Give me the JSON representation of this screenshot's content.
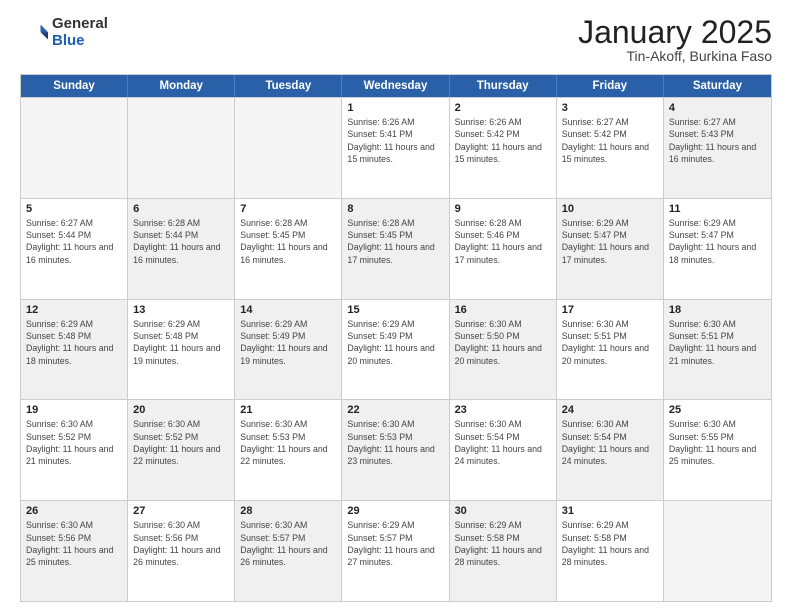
{
  "header": {
    "logo_general": "General",
    "logo_blue": "Blue",
    "title": "January 2025",
    "location": "Tin-Akoff, Burkina Faso"
  },
  "days_of_week": [
    "Sunday",
    "Monday",
    "Tuesday",
    "Wednesday",
    "Thursday",
    "Friday",
    "Saturday"
  ],
  "rows": [
    [
      {
        "day": "",
        "empty": true
      },
      {
        "day": "",
        "empty": true
      },
      {
        "day": "",
        "empty": true
      },
      {
        "day": "1",
        "sunrise": "6:26 AM",
        "sunset": "5:41 PM",
        "daylight": "11 hours and 15 minutes."
      },
      {
        "day": "2",
        "sunrise": "6:26 AM",
        "sunset": "5:42 PM",
        "daylight": "11 hours and 15 minutes."
      },
      {
        "day": "3",
        "sunrise": "6:27 AM",
        "sunset": "5:42 PM",
        "daylight": "11 hours and 15 minutes."
      },
      {
        "day": "4",
        "sunrise": "6:27 AM",
        "sunset": "5:43 PM",
        "daylight": "11 hours and 16 minutes.",
        "shaded": true
      }
    ],
    [
      {
        "day": "5",
        "sunrise": "6:27 AM",
        "sunset": "5:44 PM",
        "daylight": "11 hours and 16 minutes."
      },
      {
        "day": "6",
        "sunrise": "6:28 AM",
        "sunset": "5:44 PM",
        "daylight": "11 hours and 16 minutes.",
        "shaded": true
      },
      {
        "day": "7",
        "sunrise": "6:28 AM",
        "sunset": "5:45 PM",
        "daylight": "11 hours and 16 minutes."
      },
      {
        "day": "8",
        "sunrise": "6:28 AM",
        "sunset": "5:45 PM",
        "daylight": "11 hours and 17 minutes.",
        "shaded": true
      },
      {
        "day": "9",
        "sunrise": "6:28 AM",
        "sunset": "5:46 PM",
        "daylight": "11 hours and 17 minutes."
      },
      {
        "day": "10",
        "sunrise": "6:29 AM",
        "sunset": "5:47 PM",
        "daylight": "11 hours and 17 minutes.",
        "shaded": true
      },
      {
        "day": "11",
        "sunrise": "6:29 AM",
        "sunset": "5:47 PM",
        "daylight": "11 hours and 18 minutes."
      }
    ],
    [
      {
        "day": "12",
        "sunrise": "6:29 AM",
        "sunset": "5:48 PM",
        "daylight": "11 hours and 18 minutes.",
        "shaded": true
      },
      {
        "day": "13",
        "sunrise": "6:29 AM",
        "sunset": "5:48 PM",
        "daylight": "11 hours and 19 minutes."
      },
      {
        "day": "14",
        "sunrise": "6:29 AM",
        "sunset": "5:49 PM",
        "daylight": "11 hours and 19 minutes.",
        "shaded": true
      },
      {
        "day": "15",
        "sunrise": "6:29 AM",
        "sunset": "5:49 PM",
        "daylight": "11 hours and 20 minutes."
      },
      {
        "day": "16",
        "sunrise": "6:30 AM",
        "sunset": "5:50 PM",
        "daylight": "11 hours and 20 minutes.",
        "shaded": true
      },
      {
        "day": "17",
        "sunrise": "6:30 AM",
        "sunset": "5:51 PM",
        "daylight": "11 hours and 20 minutes."
      },
      {
        "day": "18",
        "sunrise": "6:30 AM",
        "sunset": "5:51 PM",
        "daylight": "11 hours and 21 minutes.",
        "shaded": true
      }
    ],
    [
      {
        "day": "19",
        "sunrise": "6:30 AM",
        "sunset": "5:52 PM",
        "daylight": "11 hours and 21 minutes."
      },
      {
        "day": "20",
        "sunrise": "6:30 AM",
        "sunset": "5:52 PM",
        "daylight": "11 hours and 22 minutes.",
        "shaded": true
      },
      {
        "day": "21",
        "sunrise": "6:30 AM",
        "sunset": "5:53 PM",
        "daylight": "11 hours and 22 minutes."
      },
      {
        "day": "22",
        "sunrise": "6:30 AM",
        "sunset": "5:53 PM",
        "daylight": "11 hours and 23 minutes.",
        "shaded": true
      },
      {
        "day": "23",
        "sunrise": "6:30 AM",
        "sunset": "5:54 PM",
        "daylight": "11 hours and 24 minutes."
      },
      {
        "day": "24",
        "sunrise": "6:30 AM",
        "sunset": "5:54 PM",
        "daylight": "11 hours and 24 minutes.",
        "shaded": true
      },
      {
        "day": "25",
        "sunrise": "6:30 AM",
        "sunset": "5:55 PM",
        "daylight": "11 hours and 25 minutes."
      }
    ],
    [
      {
        "day": "26",
        "sunrise": "6:30 AM",
        "sunset": "5:56 PM",
        "daylight": "11 hours and 25 minutes.",
        "shaded": true
      },
      {
        "day": "27",
        "sunrise": "6:30 AM",
        "sunset": "5:56 PM",
        "daylight": "11 hours and 26 minutes."
      },
      {
        "day": "28",
        "sunrise": "6:30 AM",
        "sunset": "5:57 PM",
        "daylight": "11 hours and 26 minutes.",
        "shaded": true
      },
      {
        "day": "29",
        "sunrise": "6:29 AM",
        "sunset": "5:57 PM",
        "daylight": "11 hours and 27 minutes."
      },
      {
        "day": "30",
        "sunrise": "6:29 AM",
        "sunset": "5:58 PM",
        "daylight": "11 hours and 28 minutes.",
        "shaded": true
      },
      {
        "day": "31",
        "sunrise": "6:29 AM",
        "sunset": "5:58 PM",
        "daylight": "11 hours and 28 minutes."
      },
      {
        "day": "",
        "empty": true
      }
    ]
  ]
}
